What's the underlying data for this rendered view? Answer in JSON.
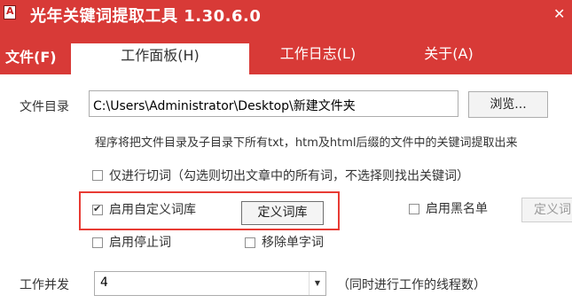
{
  "window": {
    "title": "光年关键词提取工具 1.30.6.0",
    "close_glyph": "✕"
  },
  "menu": {
    "file": "文件(F)"
  },
  "tabs": [
    {
      "label": "工作面板(H)",
      "active": true
    },
    {
      "label": "工作日志(L)",
      "active": false
    },
    {
      "label": "关于(A)",
      "active": false
    }
  ],
  "form": {
    "dir_label": "文件目录",
    "dir_value": "C:\\Users\\Administrator\\Desktop\\新建文件夹",
    "browse_button": "浏览...",
    "description": "程序将把文件目录及子目录下所有txt，htm及html后缀的文件中的关键词提取出来",
    "options": {
      "segment_only": {
        "label": "仅进行切词（勾选则切出文章中的所有词，不选择则找出关键词）",
        "checked": false
      },
      "custom_dict": {
        "label": "启用自定义词库",
        "checked": true
      },
      "define_dict_button": "定义词库",
      "blacklist": {
        "label": "启用黑名单",
        "checked": false
      },
      "define_blacklist_button": "定义词",
      "stopwords": {
        "label": "启用停止词",
        "checked": false
      },
      "remove_single": {
        "label": "移除单字词",
        "checked": false
      }
    },
    "concurrency_label": "工作并发",
    "concurrency_value": "4",
    "concurrency_hint": "（同时进行工作的线程数）"
  },
  "colors": {
    "accent": "#d83a37",
    "highlight_border": "#e83b34"
  }
}
